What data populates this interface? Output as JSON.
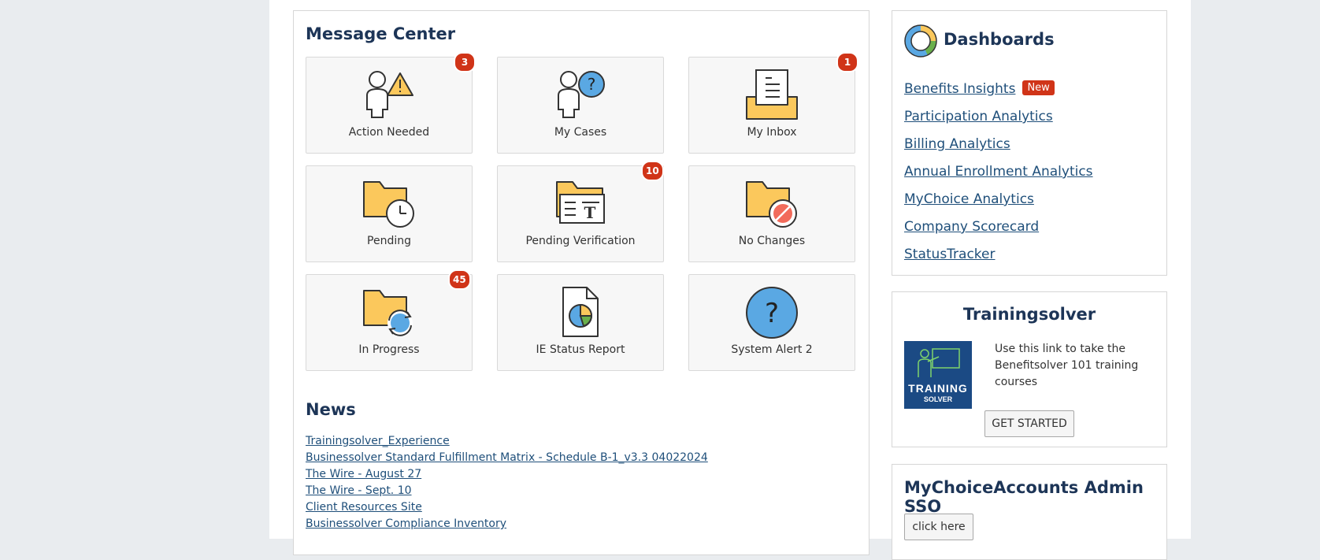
{
  "message_center": {
    "title": "Message Center",
    "tiles": [
      {
        "label": "Action Needed",
        "badge": "3",
        "icon": "person-warning-icon"
      },
      {
        "label": "My Cases",
        "badge": "",
        "icon": "person-question-icon"
      },
      {
        "label": "My Inbox",
        "badge": "1",
        "icon": "inbox-tray-icon"
      },
      {
        "label": "Pending",
        "badge": "",
        "icon": "folder-clock-icon"
      },
      {
        "label": "Pending Verification",
        "badge": "10",
        "icon": "folder-document-icon"
      },
      {
        "label": "No Changes",
        "badge": "",
        "icon": "folder-prohibited-icon"
      },
      {
        "label": "In Progress",
        "badge": "45",
        "icon": "folder-refresh-icon"
      },
      {
        "label": "IE Status Report",
        "badge": "",
        "icon": "pie-report-icon"
      },
      {
        "label": "System Alert 2",
        "badge": "",
        "icon": "question-circle-icon"
      }
    ]
  },
  "news": {
    "title": "News",
    "items": [
      "Trainingsolver_Experience",
      "Businessolver Standard Fulfillment Matrix - Schedule B-1_v3.3 04022024",
      "The Wire - August 27",
      "The Wire - Sept. 10",
      "Client Resources Site",
      "Businessolver Compliance Inventory"
    ]
  },
  "dashboards": {
    "title": "Dashboards",
    "icon": "donut-chart-icon",
    "new_label": "New",
    "links": [
      "Benefits Insights",
      "Participation Analytics",
      "Billing Analytics",
      "Annual Enrollment Analytics",
      "MyChoice Analytics",
      "Company Scorecard",
      "StatusTracker"
    ]
  },
  "trainingsolver": {
    "title": "Trainingsolver",
    "logo_line1": "TRAINING",
    "logo_line2": "SOLVER",
    "description": "Use this link to take the Benefitsolver 101 training courses",
    "button": "GET STARTED"
  },
  "sso": {
    "title": "MyChoiceAccounts Admin SSO",
    "button": "click here"
  },
  "colors": {
    "badge": "#d03418",
    "link": "#1f4f7a",
    "title": "#1d3557",
    "folder": "#fbc85c",
    "icon_blue": "#5aa8e3"
  }
}
